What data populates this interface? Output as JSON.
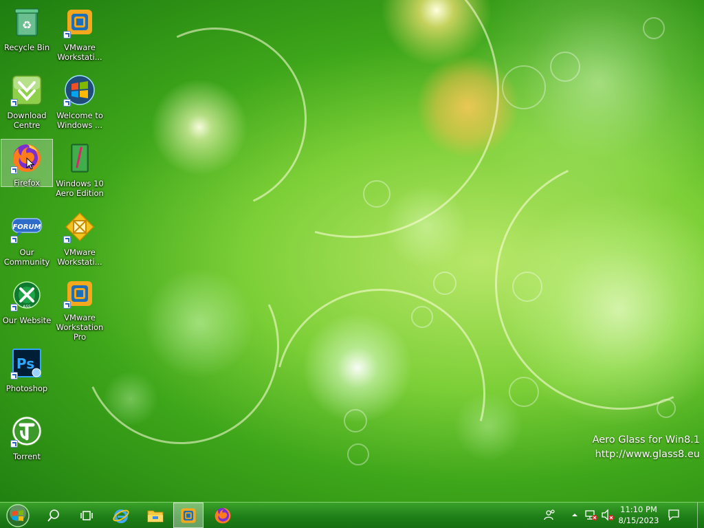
{
  "desktop": {
    "icons": [
      {
        "label": "Recycle Bin",
        "icon": "recycle-bin-icon"
      },
      {
        "label": "VMware Workstati...",
        "icon": "vmware-icon"
      },
      {
        "label": "Download Centre",
        "icon": "download-icon"
      },
      {
        "label": "Welcome to Windows ...",
        "icon": "windows-logo-icon"
      },
      {
        "label": "Firefox",
        "icon": "firefox-icon"
      },
      {
        "label": "Windows 10 Aero Edition",
        "icon": "aero-book-icon"
      },
      {
        "label": "Our Community",
        "icon": "forum-icon"
      },
      {
        "label": "VMware Workstati...",
        "icon": "vmware-alt-icon"
      },
      {
        "label": "Our Website",
        "icon": "website-globe-icon"
      },
      {
        "label": "VMware Workstation Pro",
        "icon": "vmware-icon"
      },
      {
        "label": "Photoshop",
        "icon": "photoshop-icon"
      },
      {
        "label": "Torrent",
        "icon": "utorrent-icon"
      }
    ],
    "watermark_line1": "Aero Glass for Win8.1",
    "watermark_line2": "http://www.glass8.eu"
  },
  "taskbar": {
    "clock_time": "11:10 PM",
    "clock_date": "8/15/2023",
    "pinned": [
      "start-orb-icon",
      "search-icon",
      "task-view-icon",
      "internet-explorer-icon",
      "file-explorer-icon",
      "vmware-icon",
      "firefox-icon"
    ],
    "tray": [
      "people-icon",
      "chevron-up-icon",
      "network-error-icon",
      "speaker-muted-icon",
      "action-center-icon"
    ]
  },
  "colors": {
    "taskbar": "#1f7f18",
    "accent_green": "#3ea61a",
    "firefox_orange": "#ff7b1c",
    "photoshop_blue": "#001e36"
  }
}
